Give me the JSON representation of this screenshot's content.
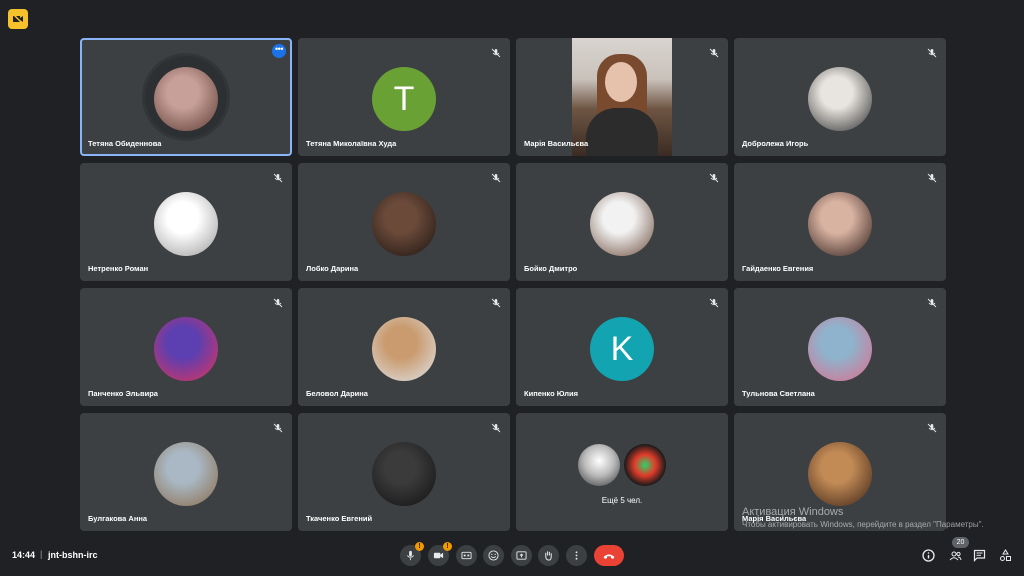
{
  "meeting": {
    "time": "14:44",
    "separator": "|",
    "code": "jnt-bshn-irc"
  },
  "participants": [
    {
      "name": "Тетяна Обиденнова",
      "avatar": "photo",
      "colors": [
        "#c7a099",
        "#5b3a33"
      ],
      "active": true
    },
    {
      "name": "Тетяна Миколаївна Худа",
      "avatar": "letter",
      "letter": "T",
      "color": "#6aa135"
    },
    {
      "name": "Марія Васильєва",
      "avatar": "video"
    },
    {
      "name": "Добролежа Игорь",
      "avatar": "photo",
      "colors": [
        "#e8e4df",
        "#2b2b2b"
      ]
    },
    {
      "name": "Нетренко Роман",
      "avatar": "photo",
      "colors": [
        "#ffffff",
        "#9a9a9a"
      ]
    },
    {
      "name": "Лобко Дарина",
      "avatar": "photo",
      "colors": [
        "#6b4a3a",
        "#1a1410"
      ]
    },
    {
      "name": "Бойко Дмитро",
      "avatar": "photo",
      "colors": [
        "#f2f2f2",
        "#6b4b3a"
      ]
    },
    {
      "name": "Гайдаенко Евгения",
      "avatar": "photo",
      "colors": [
        "#d9b3a2",
        "#2a1a15"
      ]
    },
    {
      "name": "Панченко Эльвира",
      "avatar": "photo",
      "colors": [
        "#5c3fb0",
        "#e2335a"
      ]
    },
    {
      "name": "Беловол Дарина",
      "avatar": "photo",
      "colors": [
        "#c99b6e",
        "#dfe4ea"
      ]
    },
    {
      "name": "Кипенко Юлия",
      "avatar": "letter",
      "letter": "K",
      "color": "#12a4b0"
    },
    {
      "name": "Тульнова Светлана",
      "avatar": "photo",
      "colors": [
        "#8fb3cc",
        "#e06b8c"
      ]
    },
    {
      "name": "Булгакова Анна",
      "avatar": "photo",
      "colors": [
        "#a9b8c4",
        "#8a6a48"
      ]
    },
    {
      "name": "Ткаченко Евгений",
      "avatar": "photo",
      "colors": [
        "#3b3b3b",
        "#111111"
      ]
    },
    {
      "name": "",
      "avatar": "group",
      "label": "Ещё 5 чел."
    },
    {
      "name": "Марія Васильєва",
      "avatar": "photo",
      "colors": [
        "#c28a55",
        "#3a2216"
      ]
    }
  ],
  "watermark": {
    "line1": "Активация Windows",
    "line2": "Чтобы активировать Windows, перейдите в раздел \"Параметры\"."
  },
  "controls": {
    "mic_warning": "!",
    "camera_warning": "!",
    "participants_count": "20"
  },
  "icons": {
    "app": "meet-extension-icon",
    "mute": "mic-off-icon",
    "mic": "microphone-icon",
    "camera": "camera-icon",
    "captions": "closed-captions-icon",
    "emoji": "emoji-icon",
    "present": "present-screen-icon",
    "hand": "raise-hand-icon",
    "more": "more-vert-icon",
    "hangup": "end-call-icon",
    "info": "info-icon",
    "people": "people-icon",
    "chat": "chat-icon",
    "activities": "activities-icon"
  },
  "colors": {
    "background": "#202124",
    "tile": "#3c4043",
    "accent": "#8ab4f8",
    "hangup": "#ea4335",
    "warning": "#f29900"
  }
}
